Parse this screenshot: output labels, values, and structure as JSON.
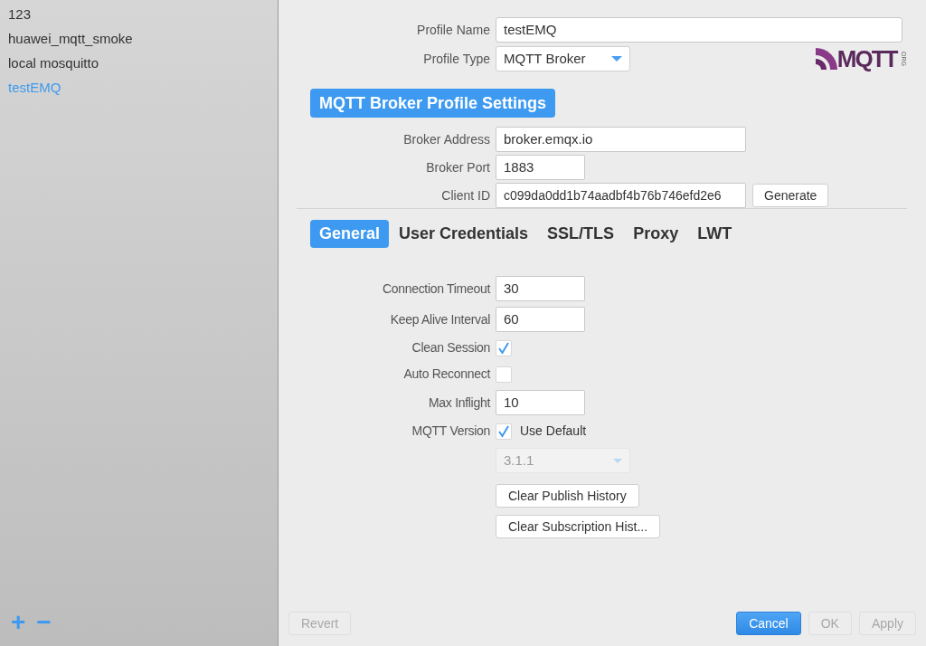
{
  "profiles": [
    {
      "name": "123",
      "selected": false
    },
    {
      "name": "huawei_mqtt_smoke",
      "selected": false
    },
    {
      "name": "local mosquitto",
      "selected": false
    },
    {
      "name": "testEMQ",
      "selected": true
    }
  ],
  "sidebar_buttons": [
    "+",
    "−"
  ],
  "profile": {
    "name_label": "Profile Name",
    "name_value": "testEMQ",
    "type_label": "Profile Type",
    "type_value": "MQTT Broker"
  },
  "logo": {
    "text": "MQTT",
    "suffix": "ORG"
  },
  "section_title": "MQTT Broker Profile Settings",
  "broker": {
    "address_label": "Broker Address",
    "address": "broker.emqx.io",
    "port_label": "Broker Port",
    "port": "1883",
    "client_id_label": "Client ID",
    "client_id": "c099da0dd1b74aadbf4b76b746efd2e6",
    "generate": "Generate"
  },
  "tabs": [
    {
      "label": "General",
      "selected": true
    },
    {
      "label": "User Credentials",
      "selected": false
    },
    {
      "label": "SSL/TLS",
      "selected": false
    },
    {
      "label": "Proxy",
      "selected": false
    },
    {
      "label": "LWT",
      "selected": false
    }
  ],
  "general": [
    {
      "kind": "field",
      "label": "Connection Timeout",
      "value": "30"
    },
    {
      "kind": "field",
      "label": "Keep Alive Interval",
      "value": "60"
    },
    {
      "kind": "checkbox",
      "label": "Clean Session",
      "checked": true
    },
    {
      "kind": "checkbox",
      "label": "Auto Reconnect",
      "checked": false
    },
    {
      "kind": "field",
      "label": "Max Inflight",
      "value": "10"
    },
    {
      "kind": "checkbox",
      "label": "MQTT Version",
      "checked": true,
      "text": "Use Default"
    },
    {
      "kind": "select",
      "value": "3.1.1",
      "disabled": true
    },
    {
      "kind": "button",
      "text": "Clear Publish History"
    },
    {
      "kind": "button",
      "text": "Clear Subscription Hist..."
    }
  ],
  "footer": [
    {
      "label": "Revert",
      "kind": "plain",
      "disabled": true
    },
    {
      "label": "Cancel",
      "kind": "primary",
      "disabled": false
    },
    {
      "label": "OK",
      "kind": "plain",
      "disabled": true
    },
    {
      "label": "Apply",
      "kind": "plain",
      "disabled": true
    }
  ]
}
